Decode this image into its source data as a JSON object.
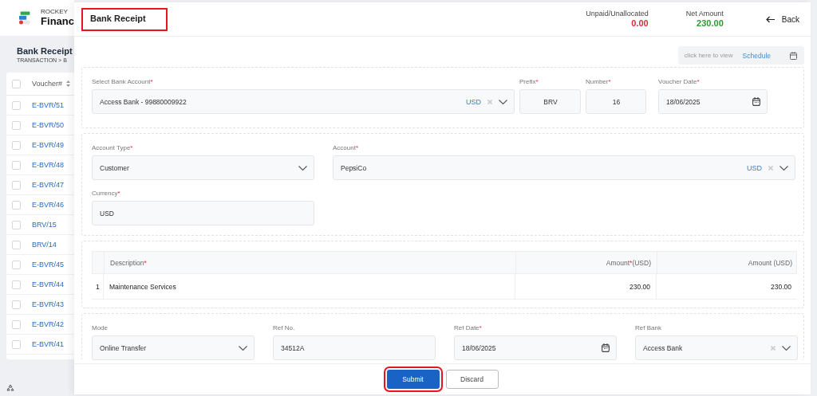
{
  "app": {
    "brand_top": "ROCKEY",
    "brand_bottom": "Financ"
  },
  "page": {
    "title": "Bank Receipt",
    "breadcrumb": "TRANSACTION > B"
  },
  "voucher_list": {
    "header_checked": false,
    "column": "Voucher#",
    "rows": [
      {
        "voucher": "E-BVR/51",
        "checked": false
      },
      {
        "voucher": "E-BVR/50",
        "checked": false
      },
      {
        "voucher": "E-BVR/49",
        "checked": false
      },
      {
        "voucher": "E-BVR/48",
        "checked": false
      },
      {
        "voucher": "E-BVR/47",
        "checked": false
      },
      {
        "voucher": "E-BVR/46",
        "checked": false
      },
      {
        "voucher": "BRV/15",
        "checked": false
      },
      {
        "voucher": "BRV/14",
        "checked": false
      },
      {
        "voucher": "E-BVR/45",
        "checked": false
      },
      {
        "voucher": "E-BVR/44",
        "checked": false
      },
      {
        "voucher": "E-BVR/43",
        "checked": false
      },
      {
        "voucher": "E-BVR/42",
        "checked": false
      },
      {
        "voucher": "E-BVR/41",
        "checked": false
      }
    ]
  },
  "drawer": {
    "title": "Bank Receipt",
    "title_highlighted": true,
    "summary": [
      {
        "label": "Unpaid/Unallocated",
        "value": "0.00",
        "color": "#e0293a"
      },
      {
        "label": "Net Amount",
        "value": "230.00",
        "color": "#2e9b2e"
      }
    ],
    "back": "Back",
    "schedule": {
      "hint": "click here to view",
      "link": "Schedule"
    },
    "sections": [
      {
        "kind": "fields",
        "fields": [
          {
            "label": "Select Bank Account",
            "mark": "*",
            "value": "Access Bank - 99880009922",
            "kind": "select",
            "currency": "USD",
            "clearable": true
          },
          {
            "label": "Prefix",
            "mark": "*",
            "value": "BRV",
            "kind": "text"
          },
          {
            "label": "Number",
            "mark": "*",
            "value": "16",
            "kind": "text"
          },
          {
            "label": "Voucher Date",
            "mark": "*",
            "value": "18/06/2025",
            "kind": "date"
          }
        ]
      },
      {
        "kind": "fields",
        "fields": [
          {
            "label": "Account Type",
            "mark": "*",
            "value": "Customer",
            "kind": "select",
            "clearable": false
          },
          {
            "label": "Account",
            "mark": "*",
            "value": "PepsiCo",
            "kind": "select",
            "currency": "USD",
            "clearable": true
          },
          {
            "label": "Currency",
            "mark": "*",
            "value": "USD",
            "kind": "text"
          }
        ]
      },
      {
        "kind": "table",
        "columns": [
          {
            "label": "Description",
            "mark": "*"
          },
          {
            "label": "Amount",
            "mark": "*",
            "suffix": "(USD)"
          },
          {
            "label": "Amount (USD)"
          }
        ],
        "rows": [
          {
            "index": "1",
            "cells": [
              "Maintenance Services",
              "230.00",
              "230.00"
            ]
          }
        ]
      },
      {
        "kind": "fields",
        "fields": [
          {
            "label": "Mode",
            "value": "Online Transfer",
            "kind": "select",
            "clearable": false
          },
          {
            "label": "Ref No.",
            "value": "34512A",
            "kind": "text"
          },
          {
            "label": "Ref Date",
            "mark": "*",
            "value": "18/06/2025",
            "kind": "date"
          },
          {
            "label": "Ref Bank",
            "value": "Access Bank",
            "kind": "select",
            "clearable": true
          }
        ]
      }
    ],
    "buttons": [
      {
        "label": "Submit",
        "kind": "primary",
        "highlighted": true
      },
      {
        "label": "Discard",
        "kind": "secondary",
        "highlighted": false
      }
    ]
  }
}
